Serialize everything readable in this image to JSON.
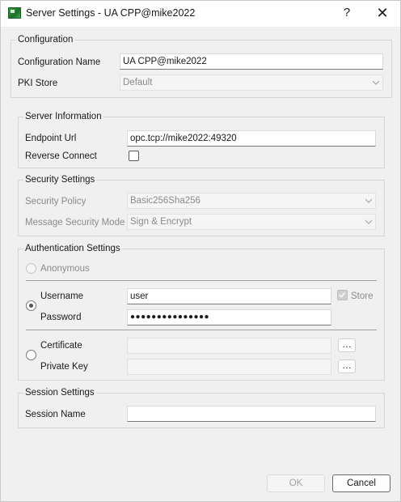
{
  "window": {
    "title": "Server Settings - UA CPP@mike2022",
    "help_glyph": "?",
    "close_glyph": "✕"
  },
  "configuration": {
    "legend": "Configuration",
    "name_label": "Configuration Name",
    "name_value": "UA CPP@mike2022",
    "pki_label": "PKI Store",
    "pki_value": "Default"
  },
  "server_info": {
    "legend": "Server Information",
    "endpoint_label": "Endpoint Url",
    "endpoint_value": "opc.tcp://mike2022:49320",
    "reverse_label": "Reverse Connect",
    "reverse_checked": false
  },
  "security": {
    "legend": "Security Settings",
    "policy_label": "Security Policy",
    "policy_value": "Basic256Sha256",
    "mode_label": "Message Security Mode",
    "mode_value": "Sign & Encrypt"
  },
  "authentication": {
    "legend": "Authentication Settings",
    "anonymous_label": "Anonymous",
    "username_label": "Username",
    "username_value": "user",
    "store_label": "Store",
    "password_label": "Password",
    "password_value": "●●●●●●●●●●●●●●●",
    "certificate_label": "Certificate",
    "private_key_label": "Private Key",
    "browse_glyph": "…"
  },
  "session": {
    "legend": "Session Settings",
    "name_label": "Session Name",
    "name_value": ""
  },
  "buttons": {
    "ok": "OK",
    "cancel": "Cancel"
  }
}
